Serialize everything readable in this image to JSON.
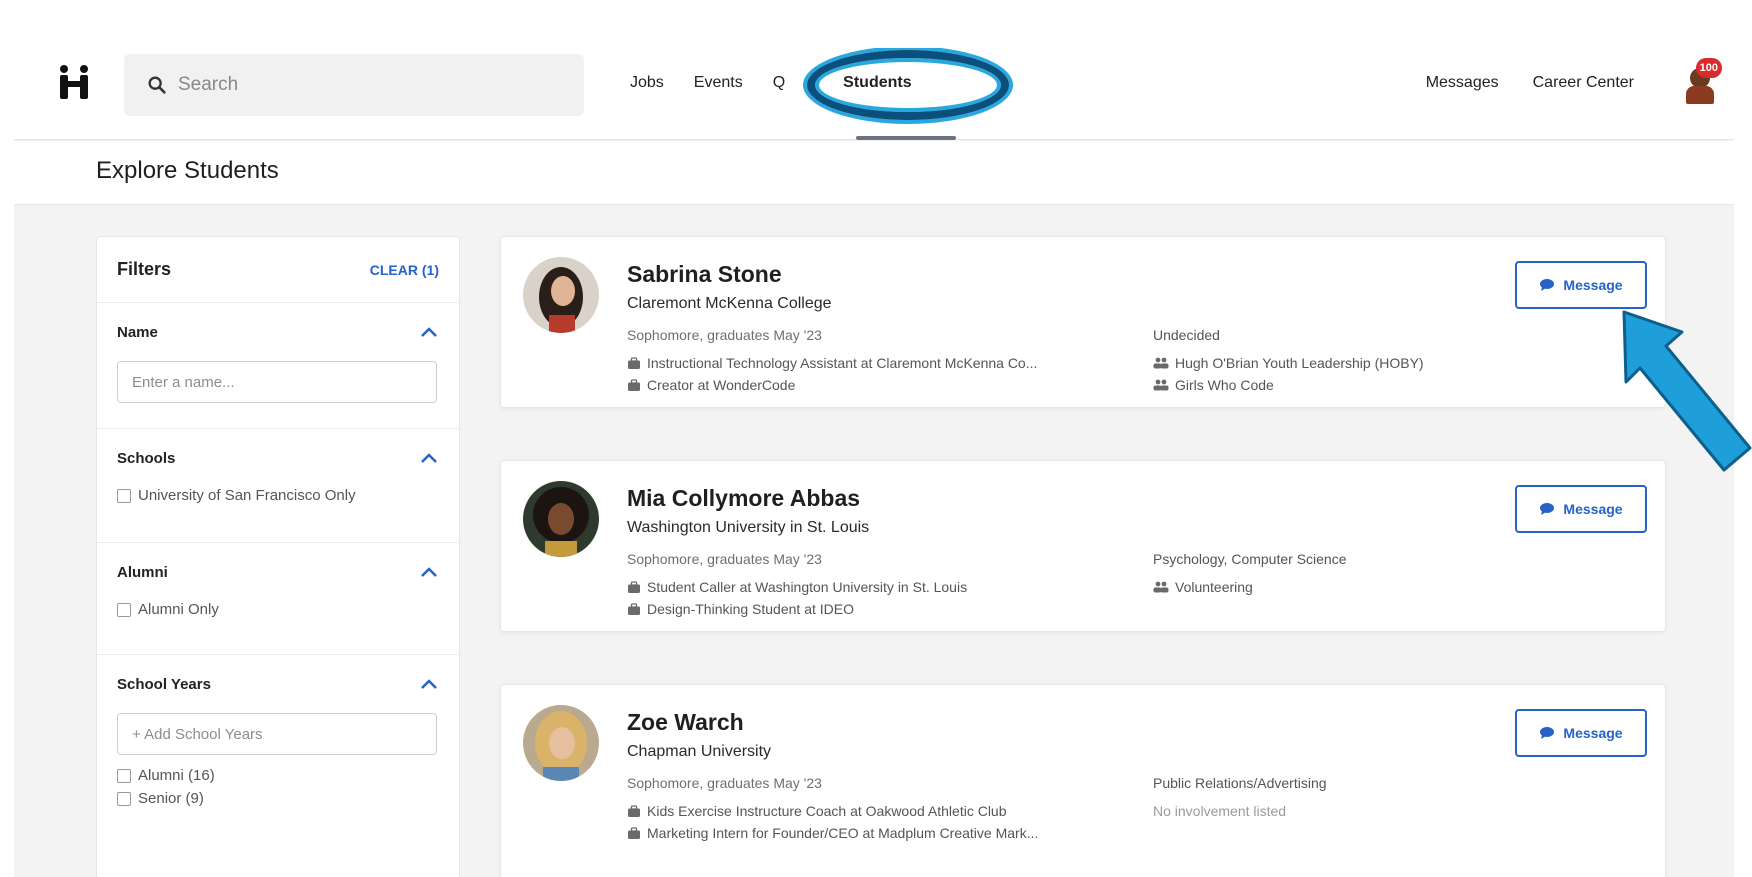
{
  "nav": {
    "search_placeholder": "Search",
    "links": [
      "Jobs",
      "Events",
      "Q",
      "Students"
    ],
    "right_links": [
      "Messages",
      "Career Center"
    ],
    "notification_count": "100"
  },
  "page": {
    "title": "Explore Students"
  },
  "filters": {
    "title": "Filters",
    "clear_label": "CLEAR (1)",
    "name": {
      "label": "Name",
      "placeholder": "Enter a name..."
    },
    "schools": {
      "label": "Schools",
      "option": "University of San Francisco Only"
    },
    "alumni": {
      "label": "Alumni",
      "option": "Alumni Only"
    },
    "school_years": {
      "label": "School Years",
      "placeholder": "+ Add School Years",
      "options": [
        "Alumni (16)",
        "Senior (9)"
      ]
    }
  },
  "students": [
    {
      "name": "Sabrina Stone",
      "school": "Claremont McKenna College",
      "year": "Sophomore, graduates May '23",
      "major": "Undecided",
      "jobs": [
        "Instructional Technology Assistant at Claremont McKenna Co...",
        "Creator at WonderCode"
      ],
      "involvement": [
        "Hugh O'Brian Youth Leadership (HOBY)",
        "Girls Who Code"
      ],
      "message_label": "Message"
    },
    {
      "name": "Mia Collymore Abbas",
      "school": "Washington University in St. Louis",
      "year": "Sophomore, graduates May '23",
      "major": "Psychology, Computer Science",
      "jobs": [
        "Student Caller at Washington University in St. Louis",
        "Design-Thinking Student at IDEO"
      ],
      "involvement": [
        "Volunteering"
      ],
      "message_label": "Message"
    },
    {
      "name": "Zoe Warch",
      "school": "Chapman University",
      "year": "Sophomore, graduates May '23",
      "major": "Public Relations/Advertising",
      "jobs": [
        "Kids Exercise Instructure Coach at Oakwood Athletic Club",
        "Marketing Intern for Founder/CEO at Madplum Creative Mark..."
      ],
      "involvement_none": "No involvement listed",
      "message_label": "Message"
    }
  ],
  "colors": {
    "accent": "#2563c9",
    "highlight": "#29a8e0",
    "badge": "#d92b2b"
  }
}
